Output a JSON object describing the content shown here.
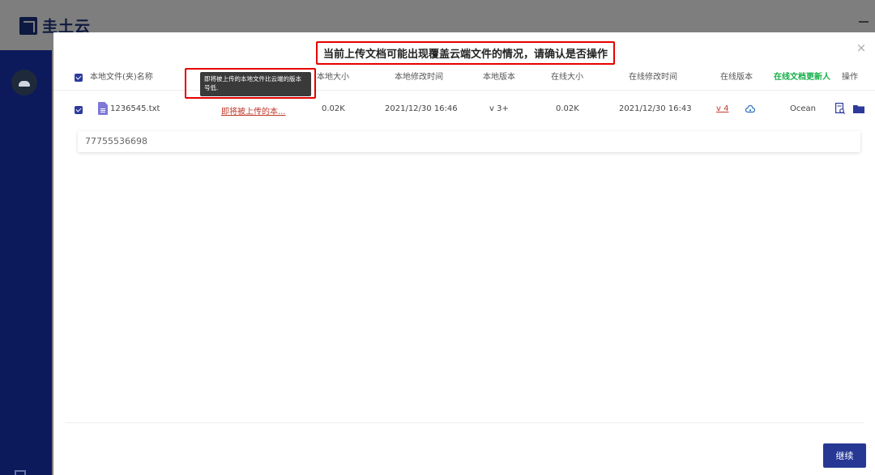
{
  "app": {
    "name": "圭土云"
  },
  "dialog": {
    "title": "当前上传文档可能出现覆盖云端文件的情况，请确认是否操作",
    "close_label": "×",
    "continue_label": "继续"
  },
  "table": {
    "headers": {
      "local_name": "本地文件(夹)名称",
      "local_size": "本地大小",
      "local_modified": "本地修改时间",
      "local_version": "本地版本",
      "online_size": "在线大小",
      "online_modified": "在线修改时间",
      "online_version": "在线版本",
      "online_updater": "在线文档更新人",
      "actions": "操作"
    },
    "tooltip": "即将被上传的本地文件比云端的版本号低.",
    "rows": [
      {
        "name": "1236545.txt",
        "status": "即将被上传的本...",
        "local_size": "0.02K",
        "local_modified": "2021/12/30 16:46",
        "local_version": "v 3+",
        "online_size": "0.02K",
        "online_modified": "2021/12/30 16:43",
        "online_version": "v 4",
        "updater": "Ocean"
      }
    ],
    "comment": "77755536698"
  },
  "colors": {
    "accent": "#263894",
    "sidebar": "#0c1a5c",
    "warning_border": "#e60000",
    "updater_header": "#16b04a"
  }
}
